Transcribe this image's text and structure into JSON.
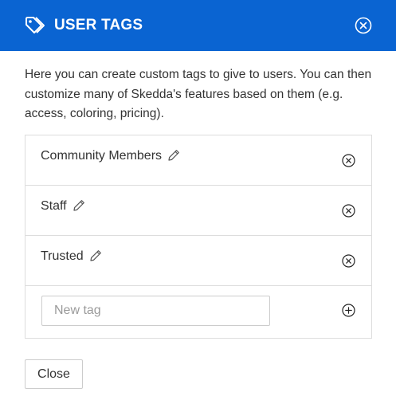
{
  "colors": {
    "header_bg": "#0a64d2",
    "header_text": "#ffffff",
    "border": "#dddddd"
  },
  "header": {
    "title": "USER TAGS",
    "tag_icon": "tag-icon",
    "close_icon": "close-circle-icon"
  },
  "intro": {
    "text": "Here you can create custom tags to give to users. You can then customize many of Skedda's features based on them (e.g. access, coloring, pricing)."
  },
  "tags": [
    {
      "name": "Community Members",
      "edit_icon": "pencil-icon",
      "remove_icon": "remove-circle-icon"
    },
    {
      "name": "Staff",
      "edit_icon": "pencil-icon",
      "remove_icon": "remove-circle-icon"
    },
    {
      "name": "Trusted",
      "edit_icon": "pencil-icon",
      "remove_icon": "remove-circle-icon"
    }
  ],
  "new_tag": {
    "value": "",
    "placeholder": "New tag",
    "add_icon": "add-circle-icon"
  },
  "footer": {
    "close_label": "Close"
  }
}
